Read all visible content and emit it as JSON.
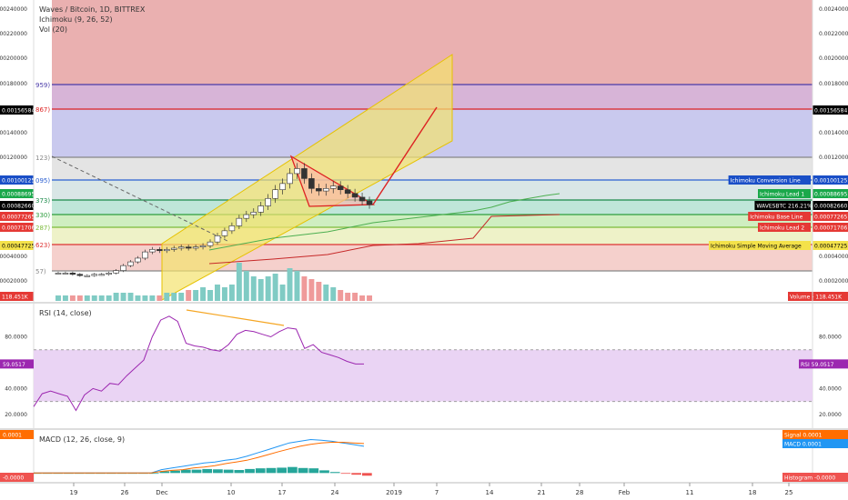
{
  "header": {
    "title": "Waves / Bitcoin, 1D, BITTREX",
    "indicator_ichimoku": "Ichimoku (9, 26, 52)",
    "indicator_vol": "Vol (20)"
  },
  "rsi_panel": {
    "title": "RSI (14, close)",
    "ticks": [
      "80.0000",
      "40.0000",
      "20.0000"
    ],
    "left_value": "59.0517",
    "right_label": "RSI",
    "right_value": "59.0517"
  },
  "macd_panel": {
    "title": "MACD (12, 26, close, 9)",
    "left_top": "0.0001",
    "left_bottom": "-0.0000",
    "signal_label": "Signal",
    "signal_value": "0.0001",
    "macd_label": "MACD",
    "macd_value": "0.0001",
    "hist_label": "Histogram",
    "hist_value": "-0.0000"
  },
  "price_axis": {
    "ticks": [
      "0.00240000",
      "0.00220000",
      "0.00200000",
      "0.00180000",
      "0.00140000",
      "0.00120000",
      "0.00040000",
      "0.00020000"
    ]
  },
  "left_price_tags": [
    {
      "value": "0.00156584",
      "bg": "#000000"
    },
    {
      "value": "0.00100125",
      "bg": "#1a4fc7"
    },
    {
      "value": "0.00088695",
      "bg": "#1aa84a"
    },
    {
      "value": "0.00082660",
      "bg": "#000000"
    },
    {
      "value": "0.00077265",
      "bg": "#e53935"
    },
    {
      "value": "0.00071706",
      "bg": "#e53935"
    },
    {
      "value": "0.00047725",
      "bg": "#f4e24a"
    }
  ],
  "right_price_tags": [
    {
      "value": "0.00156584",
      "bg": "#000000"
    },
    {
      "label": "Ichimoku Conversion Line",
      "value": "0.00100125",
      "bg": "#1a4fc7"
    },
    {
      "label": "Ichimoku Lead 1",
      "value": "0.00088695",
      "bg": "#1aa84a"
    },
    {
      "label": "WAVESBTC 216.21%",
      "value": "0.00082660",
      "bg": "#000000"
    },
    {
      "label": "Ichimoku Base Line",
      "value": "0.00077265",
      "bg": "#e53935"
    },
    {
      "label": "Ichimoku Lead 2",
      "value": "0.00071706",
      "bg": "#e53935"
    },
    {
      "label": "Ichimoku Simple Moving Average",
      "value": "0.00047725",
      "bg": "#f4e24a"
    }
  ],
  "fib_labels": [
    "959)",
    "867)",
    "123)",
    "095)",
    "373)",
    "330)",
    "287)",
    "623)",
    "57)"
  ],
  "volume": {
    "left_value": "118.451K",
    "right_label": "Volume",
    "right_value": "118.451K"
  },
  "x_axis": {
    "ticks": [
      "19",
      "26",
      "Dec",
      "10",
      "17",
      "24",
      "2019",
      "7",
      "14",
      "21",
      "28",
      "Feb",
      "11",
      "18",
      "25"
    ]
  },
  "colors": {
    "up": "#26a69a",
    "down": "#ef5350",
    "rsi": "#9c27b0",
    "macd": "#2196f3",
    "signal": "#ff6d00"
  },
  "chart_data": {
    "type": "line",
    "title": "Waves / Bitcoin, 1D, BITTREX",
    "price_ylim": [
      0.0001,
      0.0025
    ],
    "candles_x_days": [
      0,
      1,
      2,
      3,
      4,
      5,
      6,
      7,
      8,
      9,
      10,
      11,
      12,
      13,
      14,
      15,
      16,
      17,
      18,
      19,
      20,
      21,
      22,
      23,
      24,
      25,
      26,
      27,
      28,
      29,
      30,
      31,
      32,
      33,
      34,
      35,
      36,
      37,
      38,
      39,
      40,
      41,
      42,
      43
    ],
    "close": [
      0.00028,
      0.00028,
      0.00027,
      0.00026,
      0.00026,
      0.00027,
      0.00027,
      0.00028,
      0.0003,
      0.00034,
      0.00037,
      0.0004,
      0.00045,
      0.00047,
      0.00046,
      0.00047,
      0.00048,
      0.00049,
      0.00048,
      0.00049,
      0.0005,
      0.00053,
      0.00058,
      0.00062,
      0.00066,
      0.00072,
      0.00075,
      0.00077,
      0.00082,
      0.00088,
      0.00095,
      0.001,
      0.00108,
      0.00112,
      0.00104,
      0.00096,
      0.00094,
      0.00096,
      0.00098,
      0.00095,
      0.00092,
      0.00089,
      0.00086,
      0.00083
    ],
    "rsi_values": [
      26,
      36,
      38,
      36,
      34,
      23,
      35,
      40,
      38,
      44,
      43,
      50,
      56,
      62,
      80,
      93,
      96,
      92,
      75,
      73,
      72,
      70,
      69,
      74,
      82,
      85,
      84,
      82,
      80,
      84,
      87,
      86,
      71,
      74,
      68,
      66,
      64,
      61,
      59,
      59
    ],
    "macd_values": [
      0,
      0,
      0,
      0,
      0,
      0,
      0,
      0,
      0,
      0,
      0,
      0,
      0.1,
      0.15,
      0.2,
      0.25,
      0.3,
      0.33,
      0.38,
      0.42,
      0.5,
      0.6,
      0.7,
      0.8,
      0.9,
      0.95,
      1.0,
      0.98,
      0.95,
      0.9,
      0.85,
      0.8
    ],
    "signal_values": [
      0,
      0,
      0,
      0,
      0,
      0,
      0,
      0,
      0,
      0,
      0,
      0,
      0.05,
      0.08,
      0.1,
      0.15,
      0.18,
      0.22,
      0.28,
      0.33,
      0.38,
      0.46,
      0.55,
      0.64,
      0.72,
      0.8,
      0.86,
      0.9,
      0.92,
      0.92,
      0.9,
      0.88
    ],
    "volume_values": [
      2,
      2,
      2,
      2,
      2,
      2,
      2,
      2,
      3,
      3,
      3,
      2,
      2,
      2,
      2,
      3,
      3,
      3,
      4,
      4,
      5,
      4,
      6,
      5,
      6,
      14,
      11,
      9,
      8,
      9,
      10,
      6,
      12,
      11,
      9,
      8,
      7,
      6,
      5,
      4,
      3,
      3,
      2,
      2
    ]
  }
}
